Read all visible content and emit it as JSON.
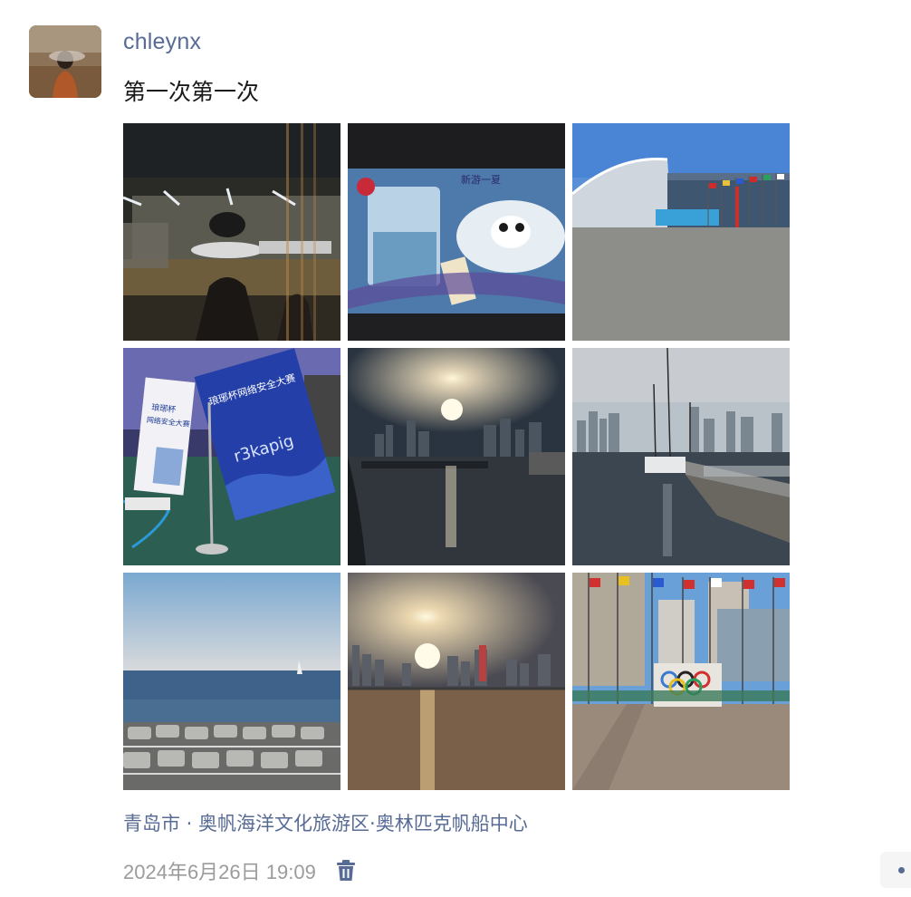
{
  "post": {
    "username": "chleynx",
    "text": "第一次第一次",
    "location": "青岛市 · 奥帆海洋文化旅游区·奥林匹克帆船中心",
    "timestamp": "2024年6月26日 19:09",
    "photo_count": 9,
    "photos": [
      {
        "id": "photo-1",
        "subject": "airport terminal at night with airplane"
      },
      {
        "id": "photo-2",
        "subject": "airline ticket folder with panda illustration"
      },
      {
        "id": "photo-3",
        "subject": "convention center with flags and blue sky"
      },
      {
        "id": "photo-4",
        "subject": "competition table flags",
        "visible_text": [
          "琅琊杯网络安全大赛",
          "r3kapig"
        ]
      },
      {
        "id": "photo-5",
        "subject": "sunset over harbor with city skyline"
      },
      {
        "id": "photo-6",
        "subject": "marina with sailboats and skyline"
      },
      {
        "id": "photo-7",
        "subject": "sea view with breakwater blocks"
      },
      {
        "id": "photo-8",
        "subject": "sunset over waterfront plaza"
      },
      {
        "id": "photo-9",
        "subject": "Olympic rings and flags at plaza"
      }
    ],
    "icons": {
      "delete": "trash-icon",
      "more": "more-dot-icon"
    }
  },
  "colors": {
    "link": "#576b95",
    "text": "#1a1a1a",
    "muted": "#9b9b9b"
  }
}
